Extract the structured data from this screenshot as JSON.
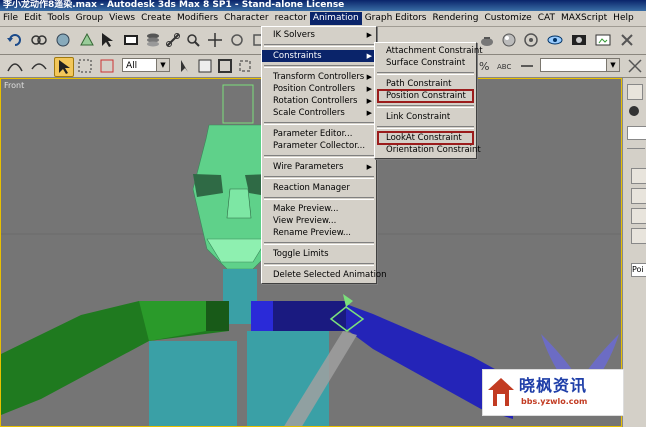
{
  "window": {
    "title": "李小龙动作8遥染.max - Autodesk 3ds Max 8 SP1 - Stand-alone License"
  },
  "menubar": {
    "items": [
      "File",
      "Edit",
      "Tools",
      "Group",
      "Views",
      "Create",
      "Modifiers",
      "Character",
      "reactor",
      "Animation",
      "Graph Editors",
      "Rendering",
      "Customize",
      "CAT",
      "MAXScript",
      "Help"
    ],
    "active_index": 9
  },
  "toolbar": {
    "selection_filter": "All"
  },
  "viewport": {
    "label": "Front"
  },
  "animation_menu": {
    "items": [
      {
        "label": "IK Solvers",
        "submenu": true
      },
      {
        "label": "Constraints",
        "submenu": true,
        "highlighted": true
      },
      {
        "label": "Transform Controllers",
        "submenu": true
      },
      {
        "label": "Position Controllers",
        "submenu": true
      },
      {
        "label": "Rotation Controllers",
        "submenu": true
      },
      {
        "label": "Scale Controllers",
        "submenu": true
      },
      {
        "label": "Parameter Editor..."
      },
      {
        "label": "Parameter Collector..."
      },
      {
        "label": "Wire Parameters",
        "submenu": true
      },
      {
        "label": "Reaction Manager"
      },
      {
        "label": "Make Preview..."
      },
      {
        "label": "View Preview..."
      },
      {
        "label": "Rename Preview..."
      },
      {
        "label": "Toggle Limits"
      },
      {
        "label": "Delete Selected Animation"
      }
    ]
  },
  "constraints_menu": {
    "items": [
      {
        "label": "Attachment Constraint"
      },
      {
        "label": "Surface Constraint"
      },
      {
        "label": "Path Constraint"
      },
      {
        "label": "Position Constraint",
        "boxed": true
      },
      {
        "label": "Link Constraint"
      },
      {
        "label": "LookAt Constraint",
        "boxed": true
      },
      {
        "label": "Orientation Constraint"
      }
    ]
  },
  "command_panel": {
    "field_text": "Poi"
  },
  "watermark": {
    "main": "晓枫资讯",
    "sub": "bbs.yzwlo.com"
  },
  "colors": {
    "head": "#5fd18a",
    "left_arm": "#1f7a1f",
    "right_arm": "#1a1aa8",
    "torso": "#3aa0a6",
    "menu_highlight": "#0a246a",
    "red_box": "#9b1c1c"
  }
}
